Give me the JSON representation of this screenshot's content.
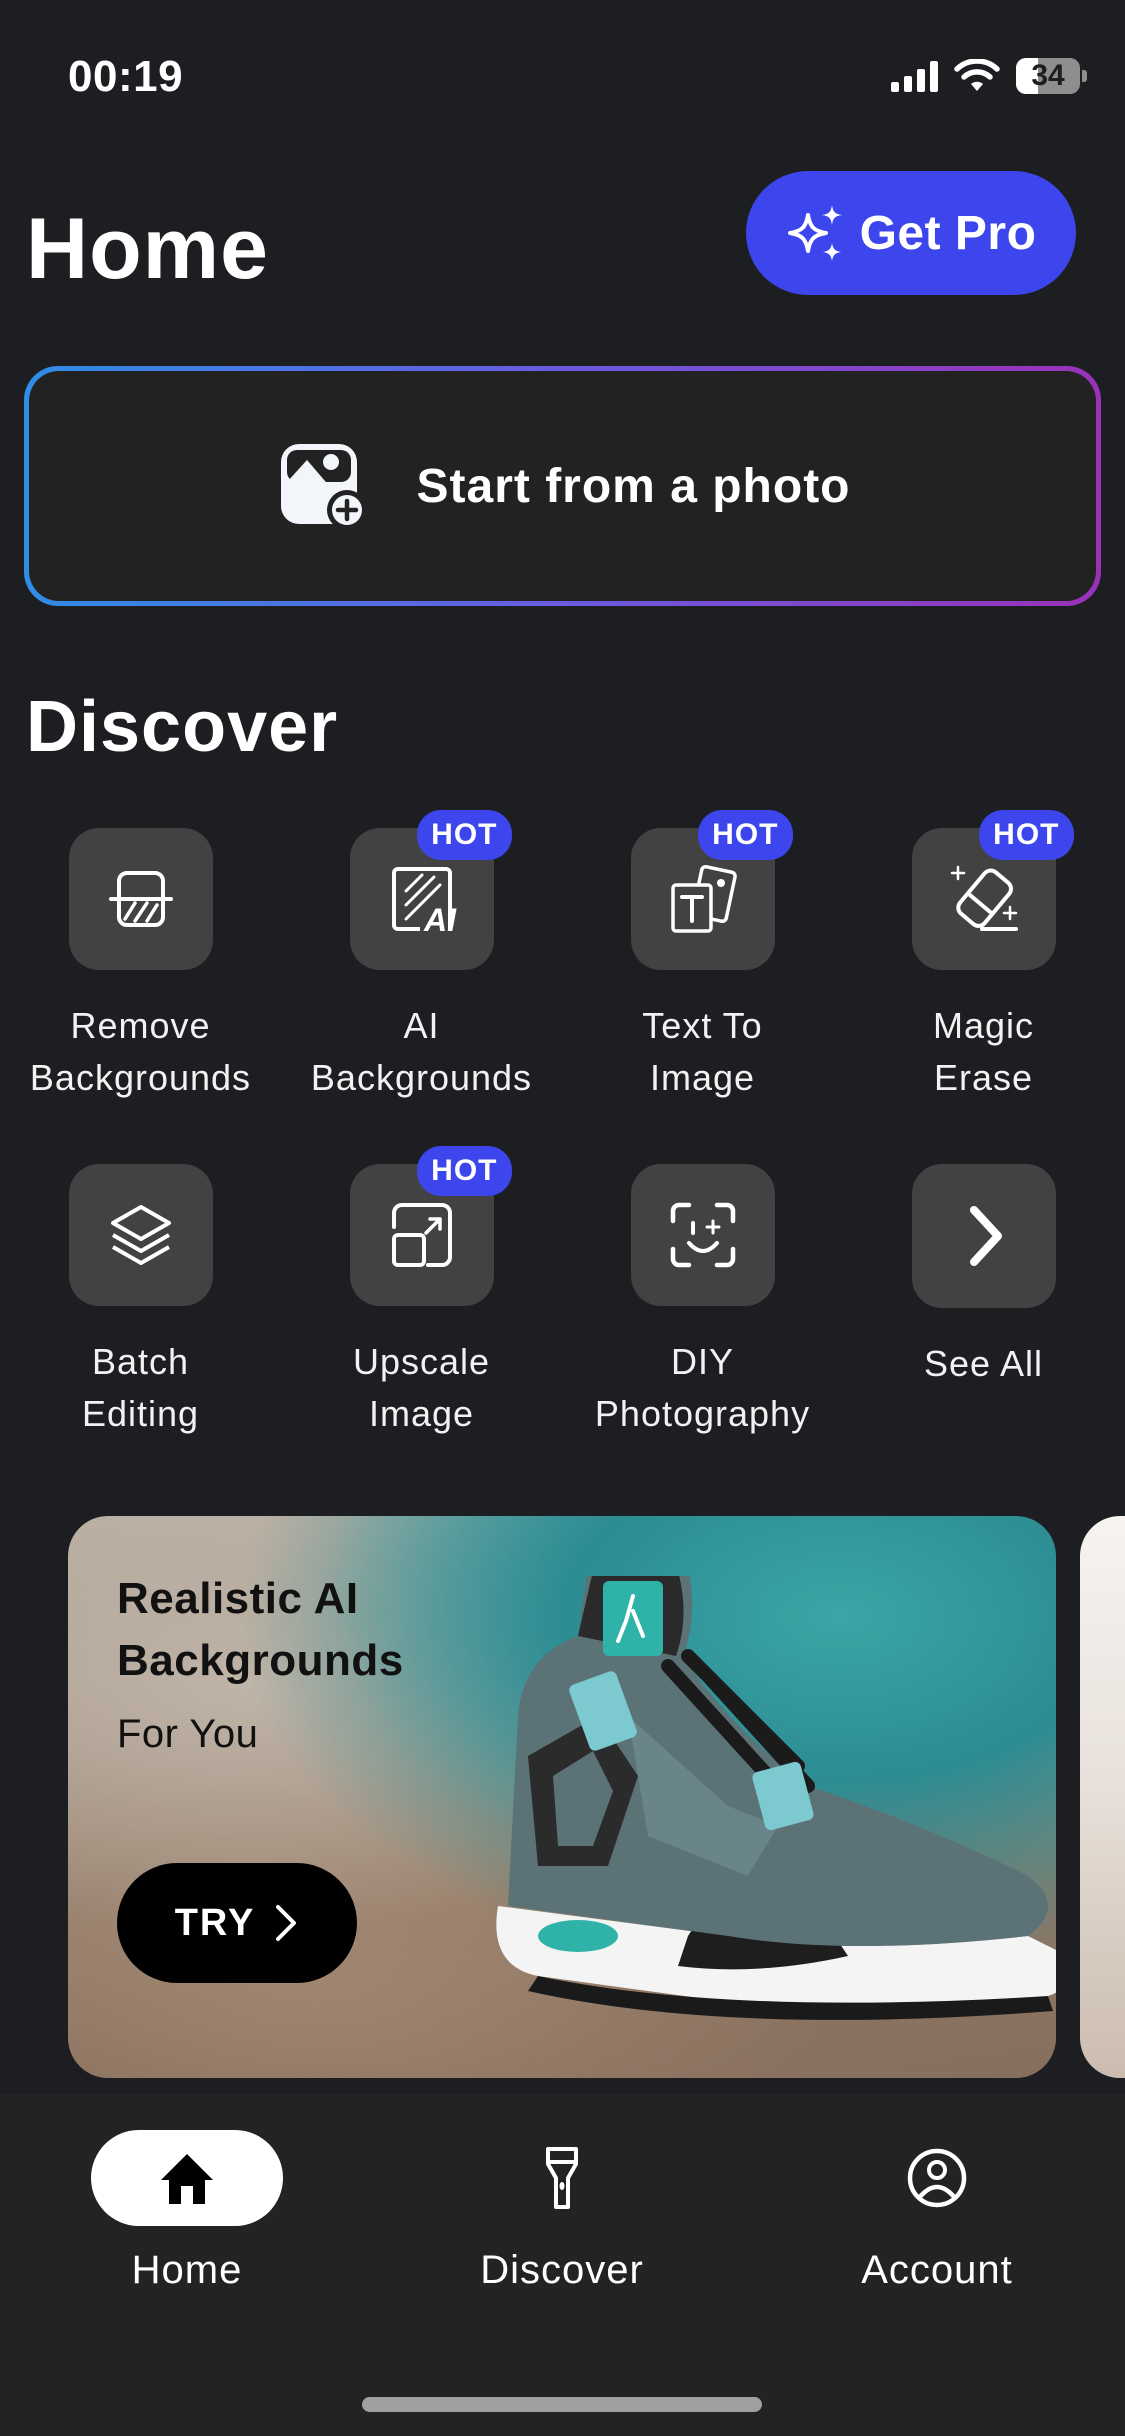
{
  "status_bar": {
    "time": "00:19",
    "battery_level": 34,
    "battery_label": "34"
  },
  "header": {
    "title": "Home",
    "get_pro_label": "Get Pro"
  },
  "start_card": {
    "label": "Start from a photo"
  },
  "discover": {
    "title": "Discover",
    "hot_label": "HOT",
    "tools": [
      {
        "name_line1": "Remove",
        "name_line2": "Backgrounds",
        "icon": "remove-background-icon",
        "hot": false
      },
      {
        "name_line1": "AI",
        "name_line2": "Backgrounds",
        "icon": "ai-background-icon",
        "hot": true
      },
      {
        "name_line1": "Text To",
        "name_line2": "Image",
        "icon": "text-to-image-icon",
        "hot": true
      },
      {
        "name_line1": "Magic",
        "name_line2": "Erase",
        "icon": "eraser-icon",
        "hot": true
      },
      {
        "name_line1": "Batch",
        "name_line2": "Editing",
        "icon": "layers-icon",
        "hot": false
      },
      {
        "name_line1": "Upscale",
        "name_line2": "Image",
        "icon": "upscale-icon",
        "hot": true
      },
      {
        "name_line1": "DIY",
        "name_line2": "Photography",
        "icon": "face-scan-icon",
        "hot": false
      },
      {
        "name_line1": "See All",
        "name_line2": "",
        "icon": "chevron-right-icon",
        "hot": false
      }
    ]
  },
  "banner": {
    "title_line1": "Realistic AI",
    "title_line2": "Backgrounds",
    "subtitle": "For You",
    "try_label": "TRY"
  },
  "tabbar": {
    "tabs": [
      {
        "label": "Home",
        "icon": "home-icon",
        "active": true
      },
      {
        "label": "Discover",
        "icon": "flashlight-icon",
        "active": false
      },
      {
        "label": "Account",
        "icon": "account-icon",
        "active": false
      }
    ]
  },
  "colors": {
    "accent": "#3d46ec",
    "background": "#1c1e21",
    "tile": "#424242",
    "tabbar": "#232323"
  }
}
